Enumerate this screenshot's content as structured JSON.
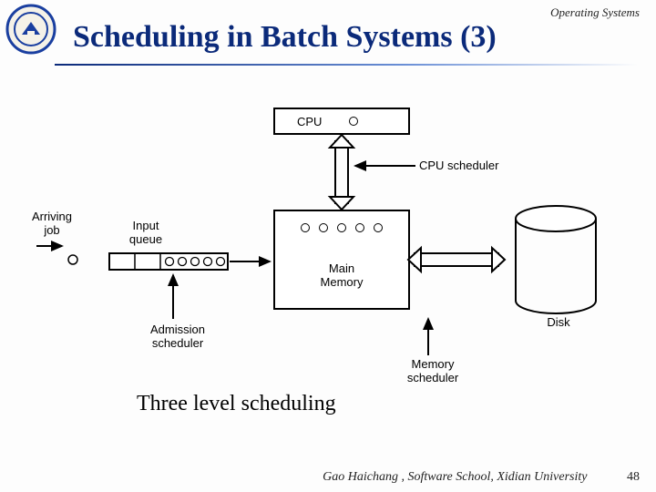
{
  "header": {
    "course": "Operating Systems",
    "title": "Scheduling in Batch Systems (3)"
  },
  "diagram": {
    "cpu_label": "CPU",
    "cpu_scheduler": "CPU scheduler",
    "arriving_job": "Arriving\njob",
    "input_queue": "Input\nqueue",
    "admission_scheduler": "Admission\nscheduler",
    "main_memory": "Main\nMemory",
    "memory_scheduler": "Memory\nscheduler",
    "disk": "Disk"
  },
  "caption": "Three level scheduling",
  "footer": {
    "author": "Gao Haichang , Software School, Xidian University",
    "page": "48"
  }
}
